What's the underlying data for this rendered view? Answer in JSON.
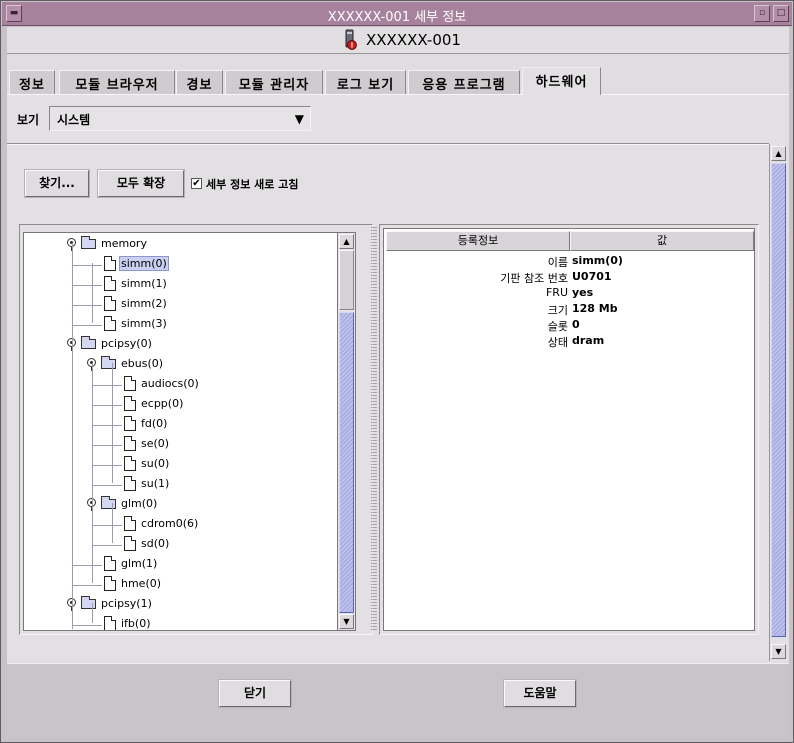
{
  "window": {
    "title": "XXXXXX-001 세부 정보",
    "menu_icon": "window-menu-icon",
    "minimize_icon": "minimize-icon",
    "maximize_icon": "maximize-icon"
  },
  "host": {
    "name": "XXXXXX-001",
    "icon": "host-alarm-icon"
  },
  "tabs": [
    {
      "label": "정보"
    },
    {
      "label": "모듈 브라우저"
    },
    {
      "label": "경보"
    },
    {
      "label": "모듈 관리자"
    },
    {
      "label": "로그 보기"
    },
    {
      "label": "응용 프로그램"
    },
    {
      "label": "하드웨어",
      "active": true
    }
  ],
  "view": {
    "label": "보기",
    "selected": "시스템",
    "arrow_icon": "dropdown-arrow-icon"
  },
  "toolbar": {
    "find_label": "찾기...",
    "expand_all_label": "모두 확장",
    "refresh_label": "세부 정보 새로 고침",
    "refresh_checked": true
  },
  "tree": {
    "nodes": [
      {
        "label": "memory",
        "type": "folder",
        "level": 0,
        "expanded": true
      },
      {
        "label": "simm(0)",
        "type": "file",
        "level": 1,
        "selected": true
      },
      {
        "label": "simm(1)",
        "type": "file",
        "level": 1
      },
      {
        "label": "simm(2)",
        "type": "file",
        "level": 1
      },
      {
        "label": "simm(3)",
        "type": "file",
        "level": 1
      },
      {
        "label": "pcipsy(0)",
        "type": "folder",
        "level": 0,
        "expanded": true
      },
      {
        "label": "ebus(0)",
        "type": "folder",
        "level": 1,
        "expanded": true
      },
      {
        "label": "audiocs(0)",
        "type": "file",
        "level": 2
      },
      {
        "label": "ecpp(0)",
        "type": "file",
        "level": 2
      },
      {
        "label": "fd(0)",
        "type": "file",
        "level": 2
      },
      {
        "label": "se(0)",
        "type": "file",
        "level": 2
      },
      {
        "label": "su(0)",
        "type": "file",
        "level": 2
      },
      {
        "label": "su(1)",
        "type": "file",
        "level": 2
      },
      {
        "label": "glm(0)",
        "type": "folder",
        "level": 1,
        "expanded": true
      },
      {
        "label": "cdrom0(6)",
        "type": "file",
        "level": 2
      },
      {
        "label": "sd(0)",
        "type": "file",
        "level": 2
      },
      {
        "label": "glm(1)",
        "type": "file",
        "level": 1
      },
      {
        "label": "hme(0)",
        "type": "file",
        "level": 1
      },
      {
        "label": "pcipsy(1)",
        "type": "folder",
        "level": 0,
        "expanded": true
      },
      {
        "label": "ifb(0)",
        "type": "file",
        "level": 1
      }
    ]
  },
  "properties": {
    "header_property": "등록정보",
    "header_value": "값",
    "rows": [
      {
        "key": "이름",
        "value": "simm(0)"
      },
      {
        "key": "기판 참조 번호",
        "value": "U0701"
      },
      {
        "key": "FRU",
        "value": "yes"
      },
      {
        "key": "크기",
        "value": "128 Mb"
      },
      {
        "key": "슬롯",
        "value": "0"
      },
      {
        "key": "상태",
        "value": "dram"
      }
    ]
  },
  "footer": {
    "close_label": "닫기",
    "help_label": "도움말"
  },
  "colors": {
    "titlebar": "#a7829d",
    "panel": "#e3e0e3",
    "scroll_thumb": "#a9aee4",
    "selection": "#ccd0f0"
  }
}
